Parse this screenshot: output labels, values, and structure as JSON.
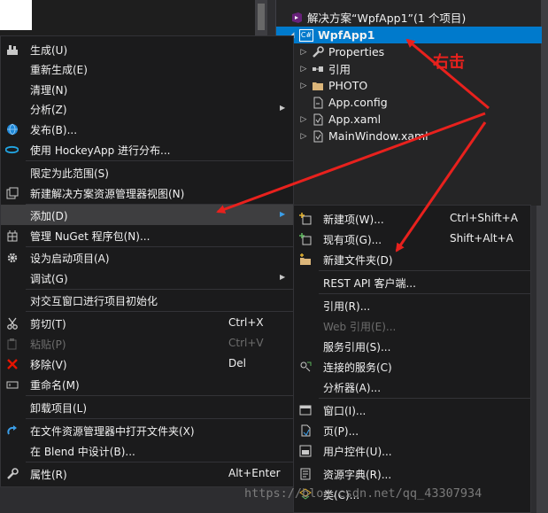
{
  "solution_explorer": {
    "solution_label": "解决方案“WpfApp1”(1 个项目)",
    "project_label": "WpfApp1",
    "project_badge": "C#",
    "nodes": [
      {
        "label": "Properties",
        "icon": "wrench-icon"
      },
      {
        "label": "引用",
        "icon": "references-icon"
      },
      {
        "label": "PHOTO",
        "icon": "folder-icon"
      },
      {
        "label": "App.config",
        "icon": "config-file-icon"
      },
      {
        "label": "App.xaml",
        "icon": "xaml-file-icon"
      },
      {
        "label": "MainWindow.xaml",
        "icon": "xaml-file-icon"
      }
    ]
  },
  "context_menu": {
    "items": [
      {
        "label": "生成(U)",
        "icon": "build-icon"
      },
      {
        "label": "重新生成(E)"
      },
      {
        "label": "清理(N)"
      },
      {
        "label": "分析(Z)",
        "submenu": true
      },
      {
        "label": "发布(B)...",
        "icon": "globe-icon"
      },
      {
        "label": "使用 HockeyApp 进行分布...",
        "icon": "hockeyapp-icon"
      },
      {
        "label": "限定为此范围(S)"
      },
      {
        "label": "新建解决方案资源管理器视图(N)",
        "icon": "new-view-icon"
      },
      {
        "label": "添加(D)",
        "submenu": true,
        "highlighted": true
      },
      {
        "label": "管理 NuGet 程序包(N)...",
        "icon": "nuget-icon"
      },
      {
        "label": "设为启动项目(A)",
        "icon": "gear-icon"
      },
      {
        "label": "调试(G)",
        "submenu": true
      },
      {
        "label": "对交互窗口进行项目初始化"
      },
      {
        "label": "剪切(T)",
        "shortcut": "Ctrl+X",
        "icon": "scissors-icon"
      },
      {
        "label": "粘贴(P)",
        "shortcut": "Ctrl+V",
        "icon": "paste-icon",
        "disabled": true
      },
      {
        "label": "移除(V)",
        "shortcut": "Del",
        "icon": "close-icon"
      },
      {
        "label": "重命名(M)",
        "icon": "rename-icon"
      },
      {
        "label": "卸载项目(L)"
      },
      {
        "label": "在文件资源管理器中打开文件夹(X)",
        "icon": "refresh-icon"
      },
      {
        "label": "在 Blend 中设计(B)..."
      },
      {
        "label": "属性(R)",
        "shortcut": "Alt+Enter",
        "icon": "wrench-icon"
      }
    ]
  },
  "add_submenu": {
    "items": [
      {
        "label": "新建项(W)...",
        "shortcut": "Ctrl+Shift+A",
        "icon": "new-item-icon"
      },
      {
        "label": "现有项(G)...",
        "shortcut": "Shift+Alt+A",
        "icon": "existing-item-icon"
      },
      {
        "label": "新建文件夹(D)",
        "icon": "new-folder-icon"
      },
      {
        "label": "REST API 客户端..."
      },
      {
        "label": "引用(R)..."
      },
      {
        "label": "Web 引用(E)...",
        "disabled": true
      },
      {
        "label": "服务引用(S)..."
      },
      {
        "label": "连接的服务(C)",
        "icon": "connected-service-icon"
      },
      {
        "label": "分析器(A)..."
      },
      {
        "label": "窗口(I)...",
        "icon": "window-icon"
      },
      {
        "label": "页(P)...",
        "icon": "page-icon"
      },
      {
        "label": "用户控件(U)...",
        "icon": "user-control-icon"
      },
      {
        "label": "资源字典(R)...",
        "icon": "resource-dictionary-icon"
      },
      {
        "label": "类(C)...",
        "icon": "class-icon"
      }
    ]
  },
  "annotation": {
    "text": "右击",
    "color": "#e8211d"
  },
  "watermark": "https://blog.csdn.net/qq_43307934",
  "colors": {
    "selection": "#007acc",
    "menu_bg": "#1b1b1c",
    "arrow": "#e8211d"
  }
}
